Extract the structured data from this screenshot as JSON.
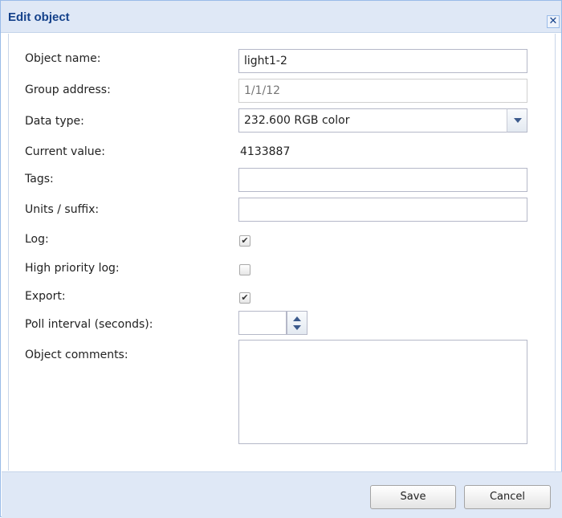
{
  "dialog": {
    "title": "Edit object",
    "close_icon": "close-icon"
  },
  "form": {
    "object_name": {
      "label": "Object name:",
      "value": "light1-2"
    },
    "group_address": {
      "label": "Group address:",
      "placeholder": "1/1/12"
    },
    "data_type": {
      "label": "Data type:",
      "value": "232.600 RGB color"
    },
    "current_value": {
      "label": "Current value:",
      "value": "4133887"
    },
    "tags": {
      "label": "Tags:",
      "value": ""
    },
    "units": {
      "label": "Units / suffix:",
      "value": ""
    },
    "log": {
      "label": "Log:",
      "checked": true
    },
    "high_priority_log": {
      "label": "High priority log:",
      "checked": false
    },
    "export": {
      "label": "Export:",
      "checked": true
    },
    "poll_interval": {
      "label": "Poll interval (seconds):",
      "value": ""
    },
    "object_comments": {
      "label": "Object comments:",
      "value": ""
    }
  },
  "buttons": {
    "save": "Save",
    "cancel": "Cancel"
  },
  "colors": {
    "header_bg": "#dfe8f6",
    "title_color": "#15428b",
    "border": "#99bbe8"
  }
}
